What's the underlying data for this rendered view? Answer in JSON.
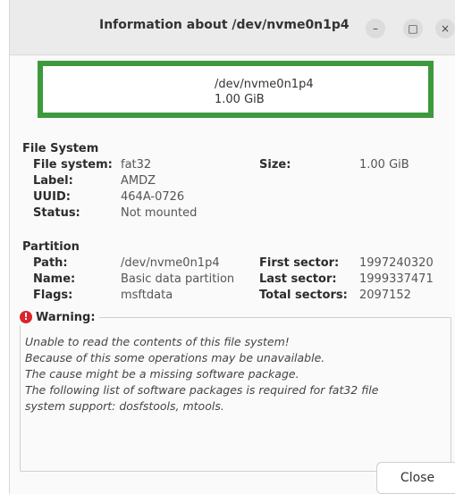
{
  "window": {
    "title": "Information about /dev/nvme0n1p4",
    "minimize_glyph": "–",
    "maximize_glyph": "□",
    "close_glyph": "×"
  },
  "device": {
    "path": "/dev/nvme0n1p4",
    "size": "1.00 GiB",
    "color_accent": "#3c9a3c"
  },
  "file_system": {
    "section_title": "File System",
    "fields": [
      {
        "label": "File system:",
        "value": "fat32"
      },
      {
        "label": "Label:",
        "value": "AMDZ"
      },
      {
        "label": "UUID:",
        "value": "464A-0726"
      },
      {
        "label": "Status:",
        "value": "Not mounted"
      }
    ],
    "size_label": "Size:",
    "size_value": "1.00 GiB"
  },
  "partition": {
    "section_title": "Partition",
    "fields": [
      {
        "label": "Path:",
        "value": "/dev/nvme0n1p4"
      },
      {
        "label": "Name:",
        "value": "Basic data partition"
      },
      {
        "label": "Flags:",
        "value": "msftdata"
      }
    ],
    "sectors": [
      {
        "label": "First sector:",
        "value": "1997240320"
      },
      {
        "label": "Last sector:",
        "value": "1999337471"
      },
      {
        "label": "Total sectors:",
        "value": "2097152"
      }
    ]
  },
  "warning": {
    "title": "Warning:",
    "icon": "warning-icon",
    "lines": [
      "Unable to read the contents of this file system!",
      "Because of this some operations may be unavailable.",
      "The cause might be a missing software package.",
      "The following list of software packages is required for fat32 file",
      "system support:  dosfstools, mtools."
    ]
  },
  "footer": {
    "close_label": "Close"
  }
}
